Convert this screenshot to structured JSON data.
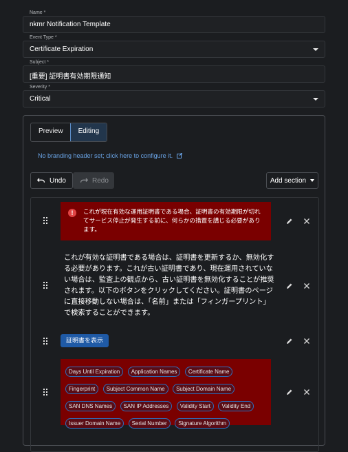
{
  "form": {
    "name": {
      "label": "Name *",
      "value": "nkmr Notification Template"
    },
    "event_type": {
      "label": "Event Type *",
      "value": "Certificate Expiration"
    },
    "subject": {
      "label": "Subject *",
      "value": "[重要] 証明書有効期限通知"
    },
    "severity": {
      "label": "Severity *",
      "value": "Critical"
    }
  },
  "editor": {
    "tabs": [
      {
        "label": "Preview"
      },
      {
        "label": "Editing"
      }
    ],
    "branding_link": "No branding header set; click here to configure it.",
    "undo_label": "Undo",
    "redo_label": "Redo",
    "add_section_label": "Add section",
    "alert_text": "これが現在有効な運用証明書である場合、証明書の有効期限が切れてサービス停止が発生する前に、何らかの措置を講じる必要があります。",
    "paragraph": "これが有効な証明書である場合は、証明書を更新するか、無効化する必要があります。これが古い証明書であり、現在運用されていない場合は、監査上の観点から、古い証明書を無効化することが推奨されます。以下のボタンをクリックしてください。証明書のページに直接移動しない場合は、「名前」または「フィンガープリント」で検索することができます。",
    "button_label": "証明書を表示",
    "chip_rows": [
      [
        "Days Until Expiration",
        "Application Names",
        "Certificate Name"
      ],
      [
        "Fingerprint",
        "Subject Common Name",
        "Subject Domain Name"
      ],
      [
        "SAN DNS Names",
        "SAN IP Addresses",
        "Validity Start",
        "Validity End"
      ],
      [
        "Issuer Domain Name",
        "Serial Number",
        "Signature Algorithm"
      ]
    ]
  },
  "colors": {
    "accent": "#5b8dc7",
    "alert_bg": "#7a0000",
    "link": "#6aa4e6",
    "button": "#1f5aa6"
  }
}
